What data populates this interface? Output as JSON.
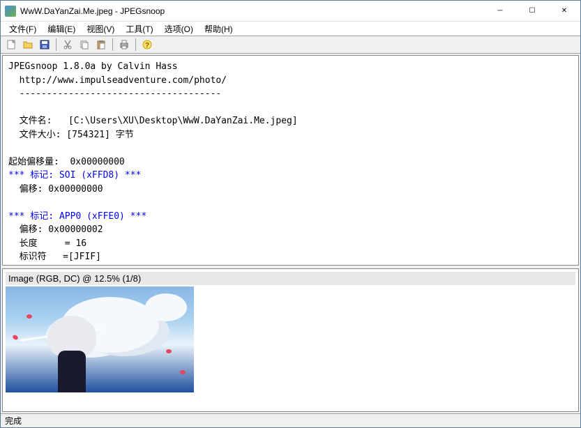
{
  "window": {
    "title": "WwW.DaYanZai.Me.jpeg - JPEGsnoop"
  },
  "menu": {
    "file": "文件(F)",
    "edit": "编辑(E)",
    "view": "视图(V)",
    "tools": "工具(T)",
    "options": "选项(O)",
    "help": "帮助(H)"
  },
  "report": {
    "header": "JPEGsnoop 1.8.0a by Calvin Hass",
    "url": "  http://www.impulseadventure.com/photo/",
    "sep": "  -------------------------------------",
    "filename_label": "  文件名:   [C:\\Users\\XU\\Desktop\\WwW.DaYanZai.Me.jpeg]",
    "filesize_label": "  文件大小: [754321] 字节",
    "start_offset": "起始偏移量:  0x00000000",
    "marker_soi": "*** 标记: SOI (xFFD8) ***",
    "soi_offset": "  偏移: 0x00000000",
    "marker_app0": "*** 标记: APP0 (xFFE0) ***",
    "app0_offset": "  偏移: 0x00000002",
    "app0_length": "  长度     = 16",
    "app0_identifier": "  标识符   =[JFIF]"
  },
  "image": {
    "caption": "Image (RGB, DC) @ 12.5% (1/8)"
  },
  "status": {
    "text": "完成"
  }
}
